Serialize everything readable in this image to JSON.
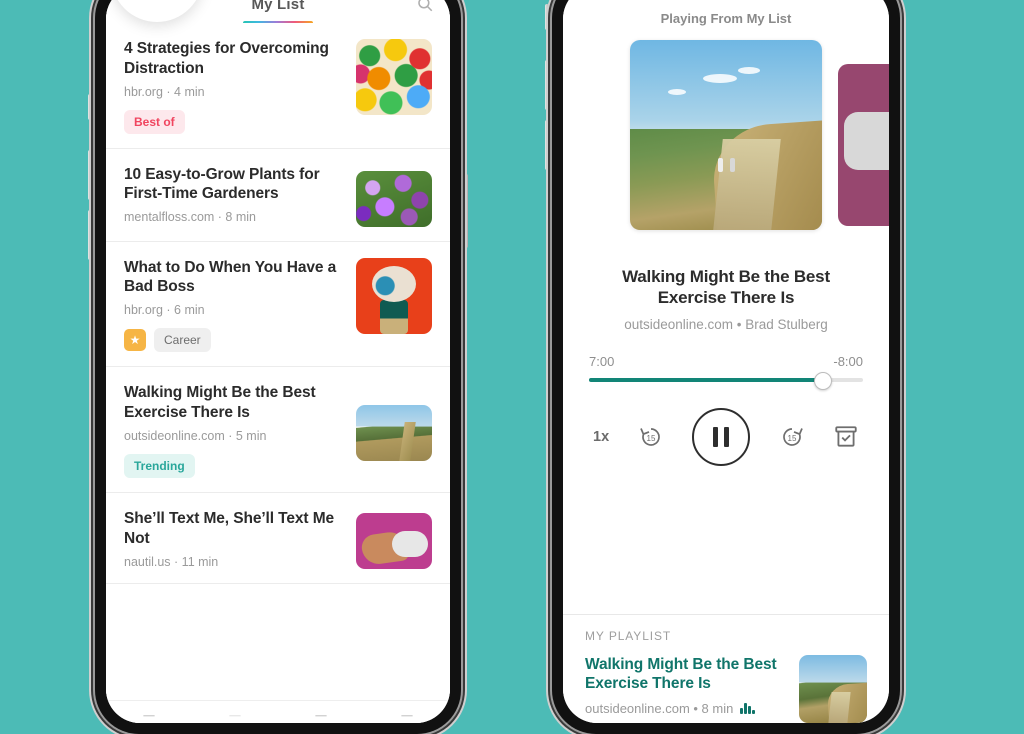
{
  "background_color": "#4cbbb6",
  "accent_teal": "#128577",
  "left_phone": {
    "topbar": {
      "brand": "My List",
      "search_icon": "search-icon"
    },
    "overlay_badge": {
      "icon": "pause-icon"
    },
    "articles": [
      {
        "title": "4 Strategies for Overcoming Distraction",
        "source": "hbr.org",
        "duration": "4 min",
        "meta": "hbr.org · 4 min",
        "tags": [
          {
            "label": "Best of",
            "style": "best"
          }
        ],
        "thumb": "balloons-image"
      },
      {
        "title": "10 Easy-to-Grow Plants for First-Time Gardeners",
        "source": "mentalfloss.com",
        "duration": "8 min",
        "meta": "mentalfloss.com · 8 min",
        "tags": [],
        "thumb": "purple-flowers-image"
      },
      {
        "title": "What to Do When You Have a Bad Boss",
        "source": "hbr.org",
        "duration": "6 min",
        "meta": "hbr.org · 6 min",
        "tags": [
          {
            "label": "",
            "style": "star"
          },
          {
            "label": "Career",
            "style": "career"
          }
        ],
        "thumb": "eyeball-character-image"
      },
      {
        "title": "Walking Might Be the Best Exercise There Is",
        "source": "outsideonline.com",
        "duration": "5 min",
        "meta": "outsideonline.com · 5 min",
        "tags": [
          {
            "label": "Trending",
            "style": "trending"
          }
        ],
        "thumb": "hillside-walkers-image"
      },
      {
        "title": "She’ll Text Me, She’ll Text Me Not",
        "source": "nautil.us",
        "duration": "11 min",
        "meta": "nautil.us · 11 min",
        "tags": [],
        "thumb": "hand-phone-image"
      }
    ]
  },
  "right_phone": {
    "playing_from": "Playing From My List",
    "cover_alt": "hillside-walkers-cover",
    "peek_cover_alt": "magenta-speech-bubble-cover",
    "track": {
      "title": "Walking Might Be the Best Exercise There Is",
      "byline": "outsideonline.com • Brad Stulberg"
    },
    "scrubber": {
      "elapsed": "7:00",
      "remaining": "-8:00",
      "progress_percent": 85
    },
    "controls": {
      "speed": "1x",
      "rewind_label": "15",
      "forward_label": "15",
      "play_state": "pause-icon",
      "archive_icon": "archive-check-icon"
    },
    "playlist": {
      "label": "MY PLAYLIST",
      "items": [
        {
          "title": "Walking Might Be the Best Exercise There Is",
          "meta": "outsideonline.com • 8 min",
          "now_playing": true,
          "thumb": "hillside-walkers-image"
        }
      ]
    }
  }
}
